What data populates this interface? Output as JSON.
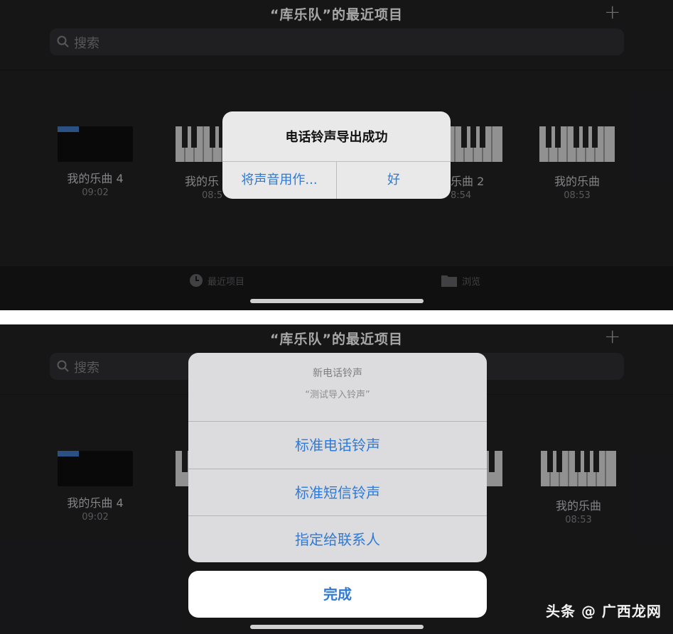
{
  "top_panel": {
    "title": "“库乐队”的最近项目",
    "search_placeholder": "搜索",
    "projects": [
      {
        "name": "我的乐曲 4",
        "time": "09:02"
      },
      {
        "name": "我的乐",
        "time": "08:5"
      },
      {
        "name": "乐曲 2",
        "time": "8:54"
      },
      {
        "name": "我的乐曲",
        "time": "08:53"
      }
    ],
    "tabs": {
      "recent": "最近项目",
      "browse": "浏览"
    },
    "alert": {
      "title": "电话铃声导出成功",
      "use_sound_label": "将声音用作...",
      "ok_label": "好"
    }
  },
  "bottom_panel": {
    "title": "“库乐队”的最近项目",
    "search_placeholder": "搜索",
    "projects": [
      {
        "name": "我的乐曲 4",
        "time": "09:02"
      },
      {
        "name": "我的乐曲",
        "time": "08:53"
      }
    ],
    "sheet": {
      "title": "新电话铃声",
      "message": "“测试导入铃声”",
      "options": [
        "标准电话铃声",
        "标准短信铃声",
        "指定给联系人"
      ],
      "done_label": "完成"
    },
    "watermark": "头条 @ 广西龙网"
  },
  "colors": {
    "accent": "#2f7ad6",
    "background": "#1f1f21"
  }
}
